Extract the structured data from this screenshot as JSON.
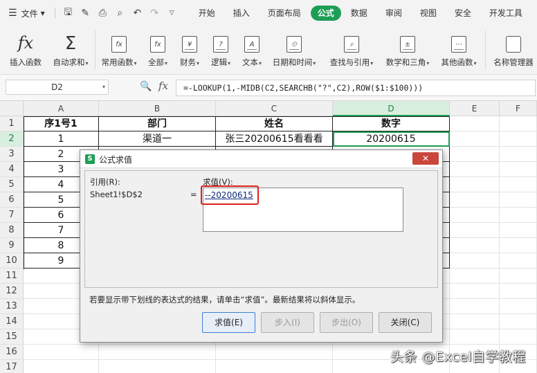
{
  "menubar": {
    "file_label": "文件",
    "tabs": [
      {
        "label": "开始",
        "active": false
      },
      {
        "label": "插入",
        "active": false
      },
      {
        "label": "页面布局",
        "active": false
      },
      {
        "label": "公式",
        "active": true
      },
      {
        "label": "数据",
        "active": false
      },
      {
        "label": "审阅",
        "active": false
      },
      {
        "label": "视图",
        "active": false
      },
      {
        "label": "安全",
        "active": false
      },
      {
        "label": "开发工具",
        "active": false
      }
    ]
  },
  "ribbon": {
    "insert_function": "插入函数",
    "autosum": "自动求和",
    "common": "常用函数",
    "all": "全部",
    "finance": "财务",
    "logic": "逻辑",
    "text": "文本",
    "datetime": "日期和时间",
    "lookup": "查找与引用",
    "math": "数学和三角",
    "other": "其他函数",
    "name_manager": "名称管理器",
    "icon_glyphs": {
      "finance": "¥",
      "logic": "?",
      "text": "A",
      "datetime": "⏲",
      "lookup": "⌕",
      "math": "±",
      "other": "⋯",
      "all": "fx",
      "common": "fx"
    }
  },
  "formula_bar": {
    "cell_ref": "D2",
    "fx_symbol": "fx",
    "formula": "=-LOOKUP(1,-MIDB(C2,SEARCHB(\"?\",C2),ROW($1:$100)))"
  },
  "sheet": {
    "columns": [
      "A",
      "B",
      "C",
      "D",
      "E",
      "F"
    ],
    "rows": [
      "1",
      "2",
      "3",
      "4",
      "5",
      "6",
      "7",
      "8",
      "9",
      "10",
      "11",
      "12",
      "13",
      "14",
      "15",
      "16",
      "17"
    ],
    "header_row": [
      "序1号1",
      "部门",
      "姓名",
      "数字"
    ],
    "row2": [
      "1",
      "渠道一",
      "张三20200615看看看",
      "20200615"
    ],
    "col_a_values": [
      "2",
      "3",
      "4",
      "5",
      "6",
      "7",
      "8",
      "9"
    ]
  },
  "dialog": {
    "title": "公式求值",
    "close_label": "✕",
    "ref_label": "引用(R):",
    "ref_value": "Sheet1!$D$2",
    "equals": "=",
    "value_label": "求值(V):",
    "value": "--20200615",
    "note": "若要显示带下划线的表达式的结果，请单击“求值”。最新结果将以斜体显示。",
    "buttons": {
      "evaluate": "求值(E)",
      "step_in": "步入(I)",
      "step_out": "步出(O)",
      "close": "关闭(C)"
    }
  },
  "watermark": "头条 @Excel自学教程"
}
